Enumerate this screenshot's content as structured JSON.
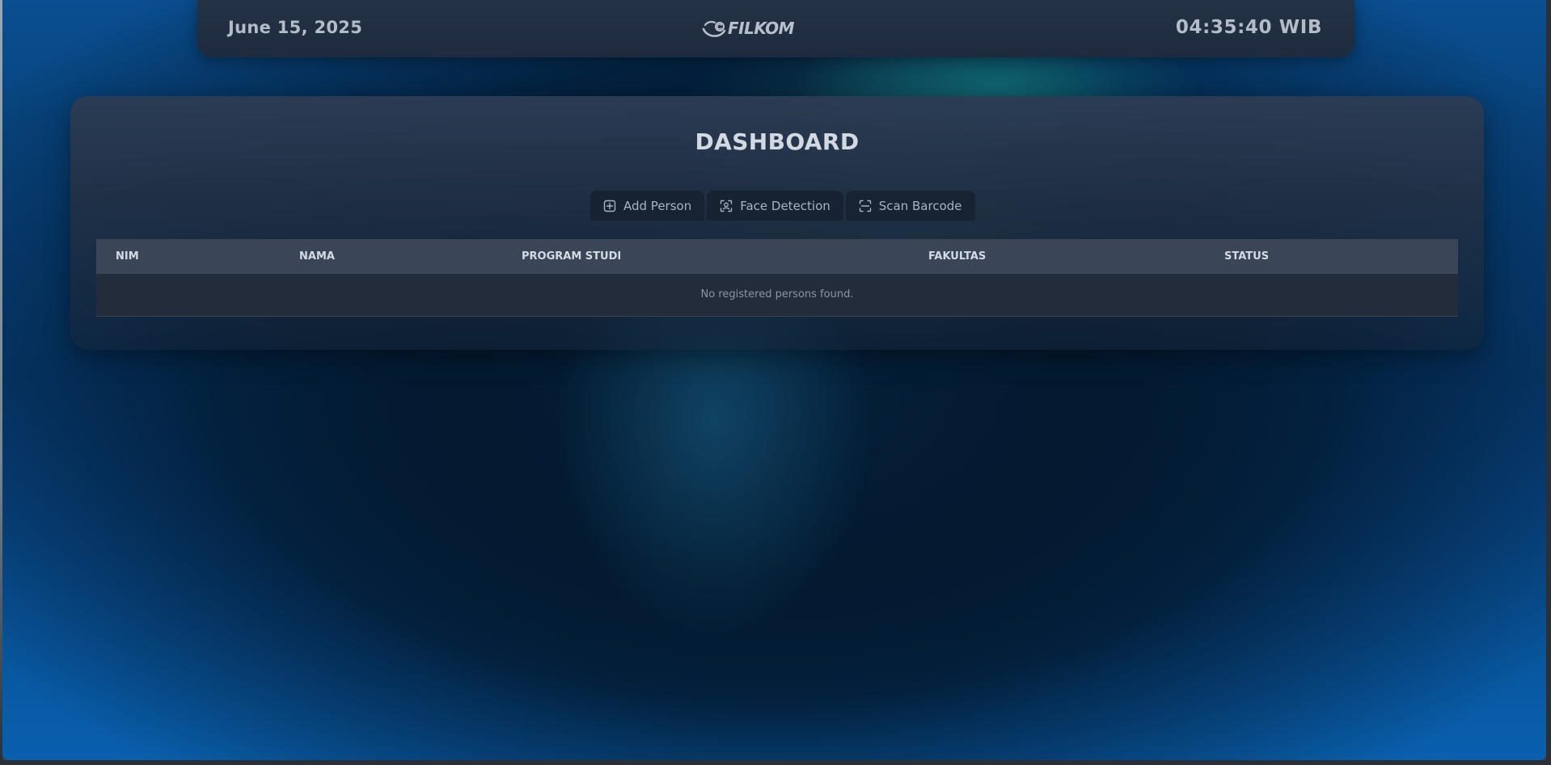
{
  "header": {
    "date": "June 15, 2025",
    "logo_text": "FILKOM",
    "clock": "04:35:40 WIB"
  },
  "main": {
    "title": "DASHBOARD",
    "tabs": [
      {
        "label": "Add Person",
        "icon": "plus-square-icon"
      },
      {
        "label": "Face Detection",
        "icon": "face-scan-icon"
      },
      {
        "label": "Scan Barcode",
        "icon": "barcode-scan-icon"
      }
    ],
    "table": {
      "columns": [
        "NIM",
        "NAMA",
        "PROGRAM STUDI",
        "FAKULTAS",
        "STATUS"
      ],
      "empty_message": "No registered persons found."
    }
  },
  "colors": {
    "panel": "#2c3c54",
    "tab_bg": "#172233",
    "table_header": "#3a4558",
    "table_row": "#222c3b",
    "text_light": "#d3d9e2",
    "background_blue": "#0a4f92"
  }
}
